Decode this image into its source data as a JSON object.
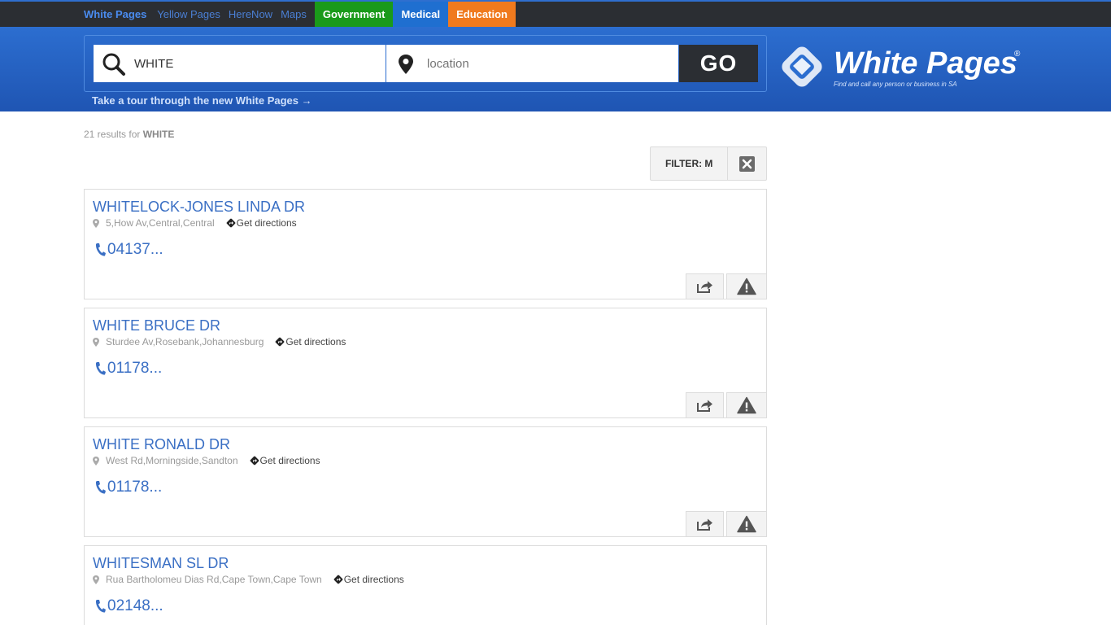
{
  "nav": {
    "links": [
      "White Pages",
      "Yellow Pages",
      "HereNow",
      "Maps"
    ],
    "pills": [
      {
        "label": "Government",
        "color": "#1a9a1a"
      },
      {
        "label": "Medical",
        "color": "#1f6fd0"
      },
      {
        "label": "Education",
        "color": "#f07a1e"
      }
    ]
  },
  "search": {
    "query_value": "WHITE",
    "location_placeholder": "location",
    "go_label": "GO",
    "tour_link": "Take a tour through the new White Pages →"
  },
  "logo": {
    "name": "White Pages",
    "registered": "®",
    "tagline": "Find and call any person or business in SA"
  },
  "results": {
    "count_text": "21 results for",
    "query": "WHITE",
    "filter_label": "FILTER: M",
    "directions_label": "Get directions",
    "items": [
      {
        "name": "WHITELOCK-JONES LINDA DR",
        "address": "5,How Av,Central,Central",
        "phone": "04137..."
      },
      {
        "name": "WHITE BRUCE DR",
        "address": "Sturdee Av,Rosebank,Johannesburg",
        "phone": "01178..."
      },
      {
        "name": "WHITE RONALD DR",
        "address": "West Rd,Morningside,Sandton",
        "phone": "01178..."
      },
      {
        "name": "WHITESMAN SL DR",
        "address": "Rua Bartholomeu Dias Rd,Cape Town,Cape Town",
        "phone": "02148..."
      }
    ]
  },
  "colors": {
    "accent": "#3a6fc4",
    "header_blue": "#2c6ed0",
    "dark": "#2b2e33"
  }
}
